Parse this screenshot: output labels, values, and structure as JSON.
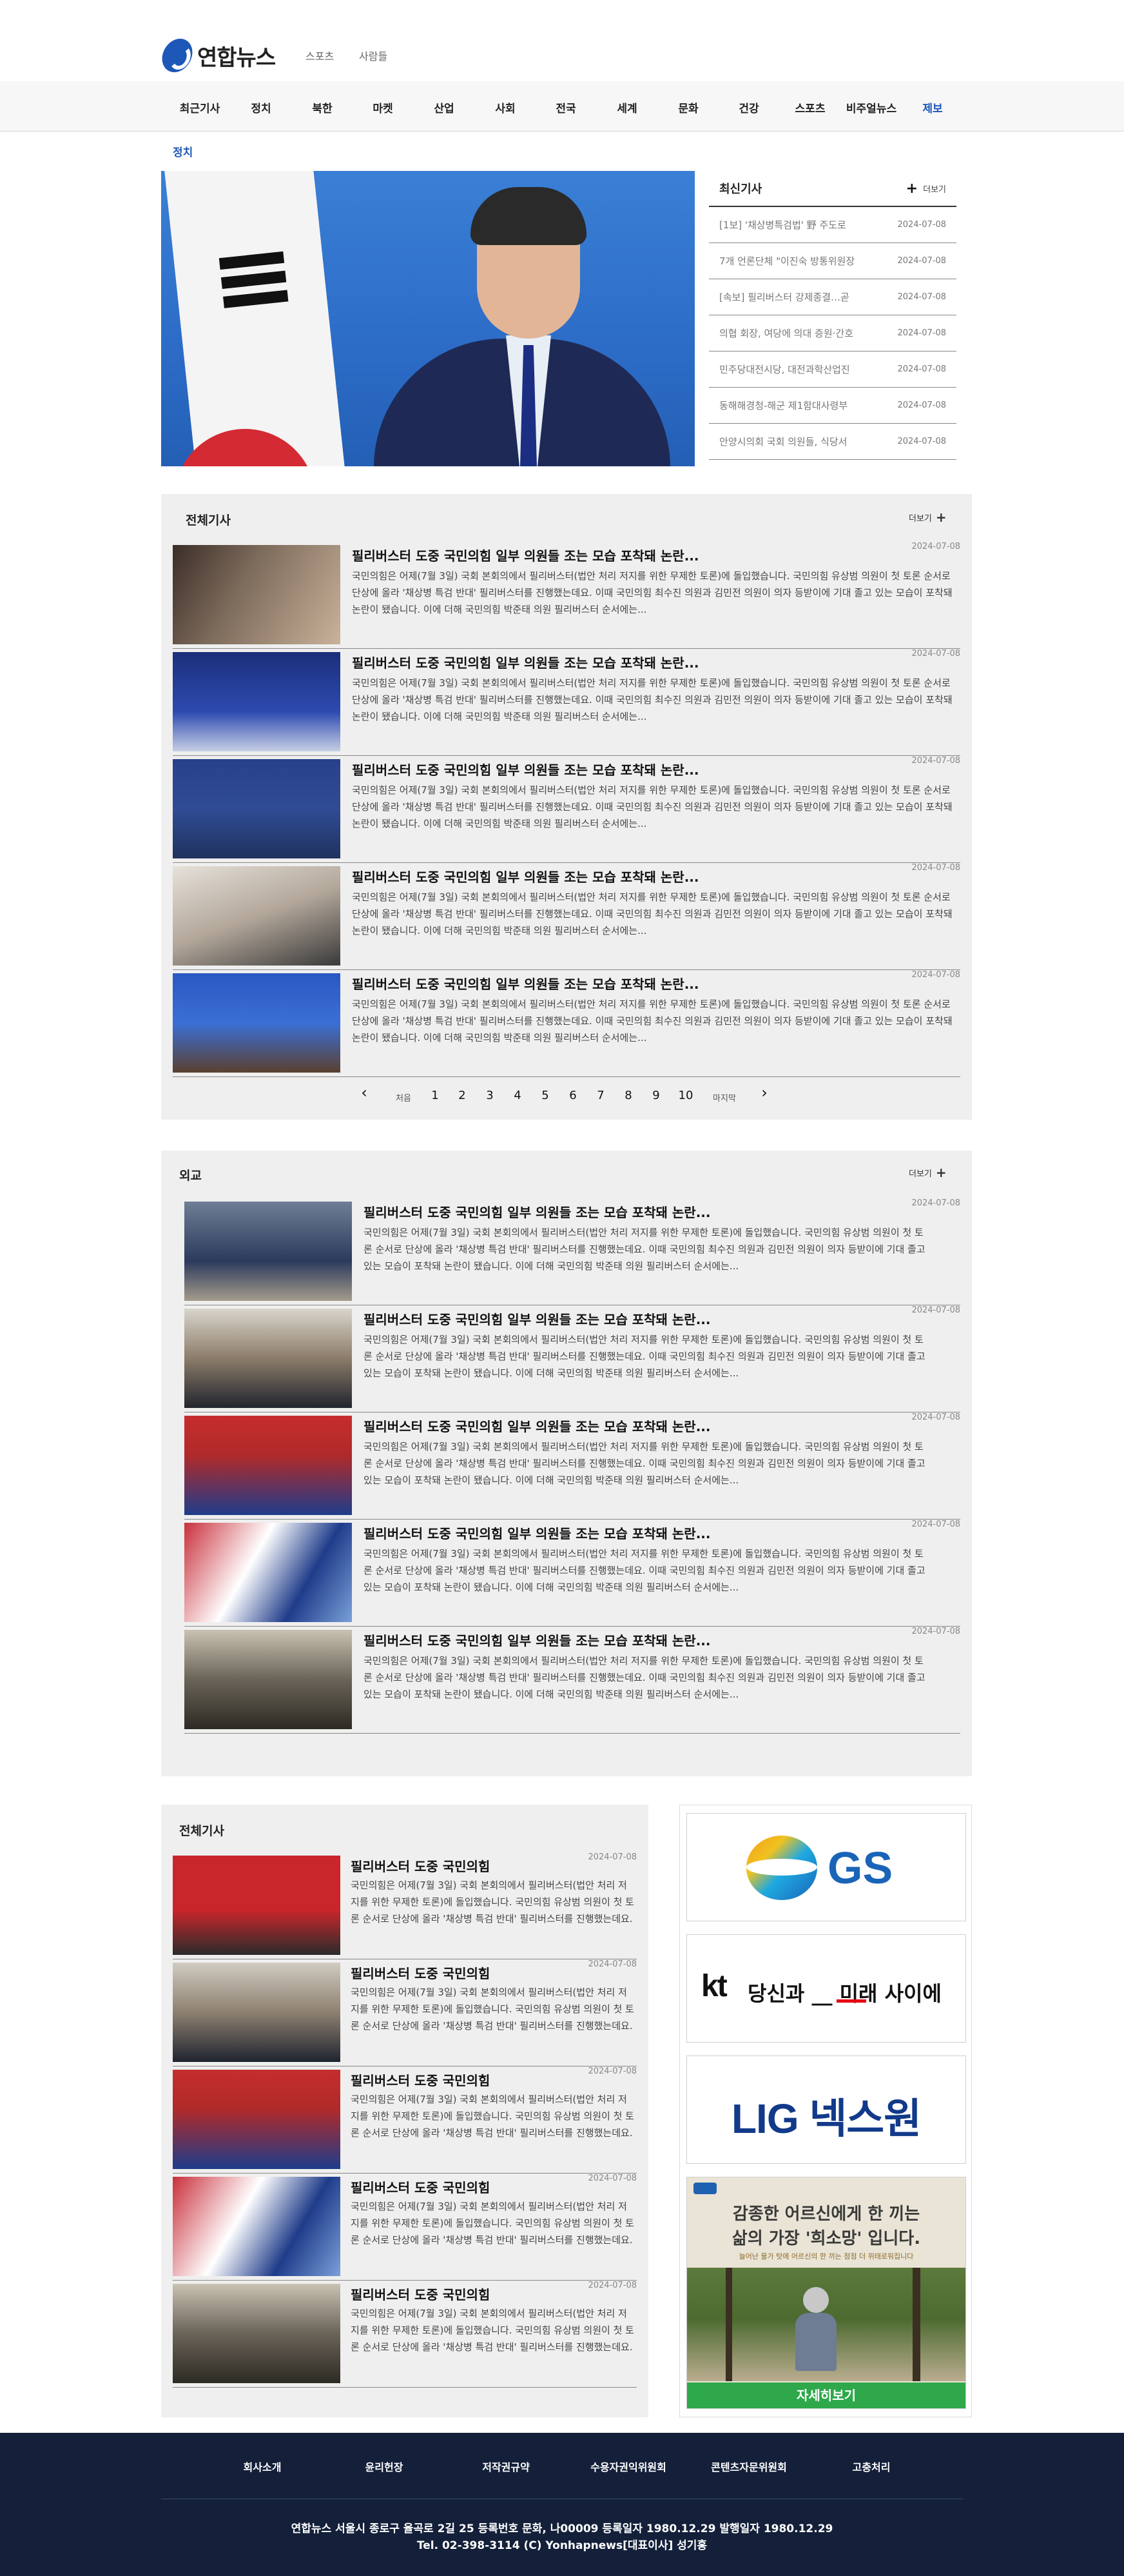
{
  "header": {
    "logo_text": "연합뉴스",
    "links": [
      "스포츠",
      "사람들"
    ]
  },
  "nav": [
    "최근기사",
    "정치",
    "북한",
    "마켓",
    "산업",
    "사회",
    "전국",
    "세계",
    "문화",
    "건강",
    "스포츠",
    "비주얼뉴스",
    "제보"
  ],
  "section_label": "정치",
  "latest": {
    "title": "최신기사",
    "more": "더보기",
    "items": [
      {
        "text": "[1보] '채상병특검법' 野 주도로",
        "date": "2024-07-08"
      },
      {
        "text": "7개 언론단체 \"이진숙 방통위원장",
        "date": "2024-07-08"
      },
      {
        "text": "[속보] 필리버스터 강제종결…곧",
        "date": "2024-07-08"
      },
      {
        "text": "의협 회장, 여당에 의대 증원·간호",
        "date": "2024-07-08"
      },
      {
        "text": "민주당대전시당, 대전과학산업진",
        "date": "2024-07-08"
      },
      {
        "text": "동해해경청-해군 제1함대사령부",
        "date": "2024-07-08"
      },
      {
        "text": "안양시의회 국회 의원들, 식당서",
        "date": "2024-07-08"
      }
    ]
  },
  "all_news": {
    "title": "전체기사",
    "more": "더보기",
    "articles": [
      {
        "headline": "필리버스터 도중 국민의힘 일부 의원들 조는 모습 포착돼 논란...",
        "date": "2024-07-08",
        "summary": "국민의힘은 어제(7월 3일) 국회 본회의에서 필리버스터(법안 처리 저지를 위한 무제한 토론)에 돌입했습니다. 국민의힘 유상범 의원이 첫 토론 순서로 단상에 올라 '채상병 특검 반대' 필리버스터를 진행했는데요. 이때 국민의힘 최수진 의원과 김민전 의원이 의자 등받이에 기대 졸고 있는 모습이 포착돼 논란이 됐습니다. 이에 더해 국민의힘 박준태 의원 필리버스터 순서에는..."
      },
      {
        "headline": "필리버스터 도중 국민의힘 일부 의원들 조는 모습 포착돼 논란...",
        "date": "2024-07-08",
        "summary": "국민의힘은 어제(7월 3일) 국회 본회의에서 필리버스터(법안 처리 저지를 위한 무제한 토론)에 돌입했습니다. 국민의힘 유상범 의원이 첫 토론 순서로 단상에 올라 '채상병 특검 반대' 필리버스터를 진행했는데요. 이때 국민의힘 최수진 의원과 김민전 의원이 의자 등받이에 기대 졸고 있는 모습이 포착돼 논란이 됐습니다. 이에 더해 국민의힘 박준태 의원 필리버스터 순서에는..."
      },
      {
        "headline": "필리버스터 도중 국민의힘 일부 의원들 조는 모습 포착돼 논란...",
        "date": "2024-07-08",
        "summary": "국민의힘은 어제(7월 3일) 국회 본회의에서 필리버스터(법안 처리 저지를 위한 무제한 토론)에 돌입했습니다. 국민의힘 유상범 의원이 첫 토론 순서로 단상에 올라 '채상병 특검 반대' 필리버스터를 진행했는데요. 이때 국민의힘 최수진 의원과 김민전 의원이 의자 등받이에 기대 졸고 있는 모습이 포착돼 논란이 됐습니다. 이에 더해 국민의힘 박준태 의원 필리버스터 순서에는..."
      },
      {
        "headline": "필리버스터 도중 국민의힘 일부 의원들 조는 모습 포착돼 논란...",
        "date": "2024-07-08",
        "summary": "국민의힘은 어제(7월 3일) 국회 본회의에서 필리버스터(법안 처리 저지를 위한 무제한 토론)에 돌입했습니다. 국민의힘 유상범 의원이 첫 토론 순서로 단상에 올라 '채상병 특검 반대' 필리버스터를 진행했는데요. 이때 국민의힘 최수진 의원과 김민전 의원이 의자 등받이에 기대 졸고 있는 모습이 포착돼 논란이 됐습니다. 이에 더해 국민의힘 박준태 의원 필리버스터 순서에는..."
      },
      {
        "headline": "필리버스터 도중 국민의힘 일부 의원들 조는 모습 포착돼 논란...",
        "date": "2024-07-08",
        "summary": "국민의힘은 어제(7월 3일) 국회 본회의에서 필리버스터(법안 처리 저지를 위한 무제한 토론)에 돌입했습니다. 국민의힘 유상범 의원이 첫 토론 순서로 단상에 올라 '채상병 특검 반대' 필리버스터를 진행했는데요. 이때 국민의힘 최수진 의원과 김민전 의원이 의자 등받이에 기대 졸고 있는 모습이 포착돼 논란이 됐습니다. 이에 더해 국민의힘 박준태 의원 필리버스터 순서에는..."
      }
    ]
  },
  "pagination": {
    "prev": "‹",
    "first": "처음",
    "pages": [
      "1",
      "2",
      "3",
      "4",
      "5",
      "6",
      "7",
      "8",
      "9",
      "10"
    ],
    "last": "마지막",
    "next": "›"
  },
  "diplomacy": {
    "title": "외교",
    "more": "더보기",
    "articles": [
      {
        "headline": "필리버스터 도중 국민의힘 일부 의원들 조는 모습 포착돼 논란...",
        "date": "2024-07-08",
        "summary": "국민의힘은 어제(7월 3일) 국회 본회의에서 필리버스터(법안 처리 저지를 위한 무제한 토론)에 돌입했습니다. 국민의힘 유상범 의원이 첫 토론 순서로 단상에 올라 '채상병 특검 반대' 필리버스터를 진행했는데요. 이때 국민의힘 최수진 의원과 김민전 의원이 의자 등받이에 기대 졸고 있는 모습이 포착돼 논란이 됐습니다. 이에 더해 국민의힘 박준태 의원 필리버스터 순서에는..."
      },
      {
        "headline": "필리버스터 도중 국민의힘 일부 의원들 조는 모습 포착돼 논란...",
        "date": "2024-07-08",
        "summary": "국민의힘은 어제(7월 3일) 국회 본회의에서 필리버스터(법안 처리 저지를 위한 무제한 토론)에 돌입했습니다. 국민의힘 유상범 의원이 첫 토론 순서로 단상에 올라 '채상병 특검 반대' 필리버스터를 진행했는데요. 이때 국민의힘 최수진 의원과 김민전 의원이 의자 등받이에 기대 졸고 있는 모습이 포착돼 논란이 됐습니다. 이에 더해 국민의힘 박준태 의원 필리버스터 순서에는..."
      },
      {
        "headline": "필리버스터 도중 국민의힘 일부 의원들 조는 모습 포착돼 논란...",
        "date": "2024-07-08",
        "summary": "국민의힘은 어제(7월 3일) 국회 본회의에서 필리버스터(법안 처리 저지를 위한 무제한 토론)에 돌입했습니다. 국민의힘 유상범 의원이 첫 토론 순서로 단상에 올라 '채상병 특검 반대' 필리버스터를 진행했는데요. 이때 국민의힘 최수진 의원과 김민전 의원이 의자 등받이에 기대 졸고 있는 모습이 포착돼 논란이 됐습니다. 이에 더해 국민의힘 박준태 의원 필리버스터 순서에는..."
      },
      {
        "headline": "필리버스터 도중 국민의힘 일부 의원들 조는 모습 포착돼 논란...",
        "date": "2024-07-08",
        "summary": "국민의힘은 어제(7월 3일) 국회 본회의에서 필리버스터(법안 처리 저지를 위한 무제한 토론)에 돌입했습니다. 국민의힘 유상범 의원이 첫 토론 순서로 단상에 올라 '채상병 특검 반대' 필리버스터를 진행했는데요. 이때 국민의힘 최수진 의원과 김민전 의원이 의자 등받이에 기대 졸고 있는 모습이 포착돼 논란이 됐습니다. 이에 더해 국민의힘 박준태 의원 필리버스터 순서에는..."
      },
      {
        "headline": "필리버스터 도중 국민의힘 일부 의원들 조는 모습 포착돼 논란...",
        "date": "2024-07-08",
        "summary": "국민의힘은 어제(7월 3일) 국회 본회의에서 필리버스터(법안 처리 저지를 위한 무제한 토론)에 돌입했습니다. 국민의힘 유상범 의원이 첫 토론 순서로 단상에 올라 '채상병 특검 반대' 필리버스터를 진행했는데요. 이때 국민의힘 최수진 의원과 김민전 의원이 의자 등받이에 기대 졸고 있는 모습이 포착돼 논란이 됐습니다. 이에 더해 국민의힘 박준태 의원 필리버스터 순서에는..."
      }
    ]
  },
  "all_news_2": {
    "title": "전체기사",
    "articles": [
      {
        "headline": "필리버스터 도중 국민의힘",
        "date": "2024-07-08",
        "summary": "국민의힘은 어제(7월 3일) 국회 본회의에서 필리버스터(법안 처리 저지를 위한 무제한 토론)에 돌입했습니다. 국민의힘 유상범 의원이 첫 토론 순서로 단상에 올라 '채상병 특검 반대' 필리버스터를 진행했는데요."
      },
      {
        "headline": "필리버스터 도중 국민의힘",
        "date": "2024-07-08",
        "summary": "국민의힘은 어제(7월 3일) 국회 본회의에서 필리버스터(법안 처리 저지를 위한 무제한 토론)에 돌입했습니다. 국민의힘 유상범 의원이 첫 토론 순서로 단상에 올라 '채상병 특검 반대' 필리버스터를 진행했는데요."
      },
      {
        "headline": "필리버스터 도중 국민의힘",
        "date": "2024-07-08",
        "summary": "국민의힘은 어제(7월 3일) 국회 본회의에서 필리버스터(법안 처리 저지를 위한 무제한 토론)에 돌입했습니다. 국민의힘 유상범 의원이 첫 토론 순서로 단상에 올라 '채상병 특검 반대' 필리버스터를 진행했는데요."
      },
      {
        "headline": "필리버스터 도중 국민의힘",
        "date": "2024-07-08",
        "summary": "국민의힘은 어제(7월 3일) 국회 본회의에서 필리버스터(법안 처리 저지를 위한 무제한 토론)에 돌입했습니다. 국민의힘 유상범 의원이 첫 토론 순서로 단상에 올라 '채상병 특검 반대' 필리버스터를 진행했는데요."
      },
      {
        "headline": "필리버스터 도중 국민의힘",
        "date": "2024-07-08",
        "summary": "국민의힘은 어제(7월 3일) 국회 본회의에서 필리버스터(법안 처리 저지를 위한 무제한 토론)에 돌입했습니다. 국민의힘 유상범 의원이 첫 토론 순서로 단상에 올라 '채상병 특검 반대' 필리버스터를 진행했는데요."
      }
    ]
  },
  "ads": {
    "gs": "GS",
    "kt_brand": "kt",
    "kt_slogan": "당신과 __ 미래 사이에",
    "lig": "LIG 넥스원",
    "campaign_line1": "감종한 어르신에게 한 끼는",
    "campaign_line2": "삶의 가장 '희소망' 입니다.",
    "campaign_line3": "늘어난 물가 탓에 어르신의 한 끼는 점점 더 위태로워집니다",
    "campaign_button": "자세히보기"
  },
  "footer": {
    "links": [
      "회사소개",
      "윤리헌장",
      "저작권규약",
      "수용자권익위원회",
      "콘텐츠자문위원회",
      "고충처리"
    ],
    "info_line1": "연합뉴스 서울시 종로구 율곡로 2길 25 등록번호 문화, 나00009 등록일자 1980.12.29 발행일자 1980.12.29",
    "info_line2": "Tel. 02-398-3114 (C) Yonhapnews[대표이사] 성기홍"
  },
  "colors": {
    "brand_blue": "#1d57b8",
    "footer_navy": "#14203a",
    "panel_gray": "#efefef"
  }
}
